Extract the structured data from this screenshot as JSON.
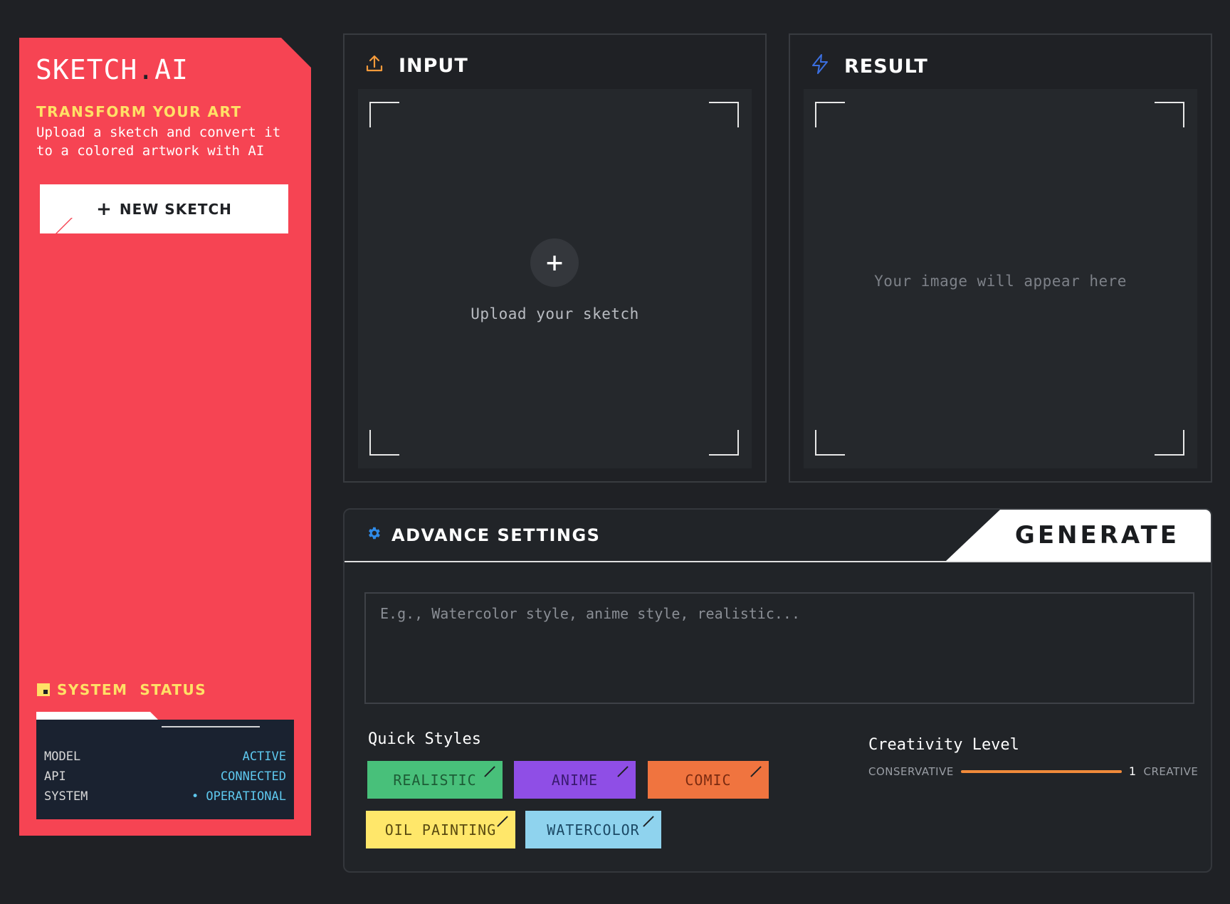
{
  "sidebar": {
    "logo_main": "SKETCH",
    "logo_dot": ".",
    "logo_suffix": "AI",
    "tagline": "TRANSFORM YOUR ART",
    "description": "Upload a sketch and convert it to a colored artwork with AI",
    "new_button": {
      "icon": "plus-icon",
      "label": "NEW SKETCH"
    },
    "status_title": "SYSTEM  STATUS",
    "status": [
      {
        "key": "MODEL",
        "value": "ACTIVE"
      },
      {
        "key": "API",
        "value": "CONNECTED"
      },
      {
        "key": "SYSTEM",
        "value": "• OPERATIONAL"
      }
    ]
  },
  "input_panel": {
    "icon": "upload-icon",
    "title": "INPUT",
    "upload_icon": "+",
    "upload_text": "Upload your sketch"
  },
  "result_panel": {
    "icon": "lightning-icon",
    "title": "RESULT",
    "placeholder": "Your image will appear here"
  },
  "settings": {
    "icon": "gear-icon",
    "title": "ADVANCE SETTINGS",
    "generate_label": "GENERATE",
    "prompt_placeholder": "E.g., Watercolor style, anime style, realistic...",
    "prompt_value": "",
    "quick_styles_label": "Quick Styles",
    "styles": [
      {
        "label": "REALISTIC",
        "color": "#48c07a",
        "text": "#1d5c36"
      },
      {
        "label": "ANIME",
        "color": "#8f4ee6",
        "text": "#3a1a70"
      },
      {
        "label": "COMIC",
        "color": "#f0743f",
        "text": "#7a2a10"
      },
      {
        "label": "OIL PAINTING",
        "color": "#ffe76a",
        "text": "#5a4a10"
      },
      {
        "label": "WATERCOLOR",
        "color": "#8fd3ee",
        "text": "#1c4a66"
      }
    ],
    "creativity_label": "Creativity Level",
    "slider_min_label": "CONSERVATIVE",
    "slider_value": "1",
    "slider_max_label": "CREATIVE"
  },
  "colors": {
    "background": "#1f2125",
    "sidebar": "#f64453",
    "accent_yellow": "#ffe066",
    "status_blue": "#5ec8ee",
    "slider_orange": "#f08a3a",
    "result_icon_blue": "#3b6fe0",
    "input_icon_orange": "#f39a3b",
    "gear_blue": "#2f8be8"
  }
}
